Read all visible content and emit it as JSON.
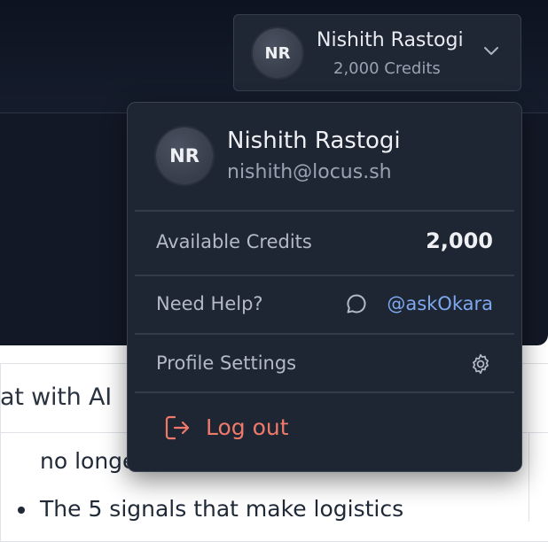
{
  "profile": {
    "initials": "NR",
    "name": "Nishith Rastogi",
    "credits_label": "2,000 Credits"
  },
  "dropdown": {
    "initials": "NR",
    "name": "Nishith Rastogi",
    "email": "nishith@locus.sh",
    "available_credits_label": "Available Credits",
    "available_credits_value": "2,000",
    "help_label": "Need Help?",
    "help_link": "@askOkara",
    "profile_settings_label": "Profile Settings",
    "logout_label": "Log out"
  },
  "background": {
    "article_header": "at with AI",
    "article_line1": "no longe",
    "article_line2": "The 5 signals that make logistics"
  },
  "icons": {
    "chevron": "chevron-down-icon",
    "chat": "chat-bubble-icon",
    "gear": "gear-icon",
    "logout": "logout-icon"
  },
  "colors": {
    "logout": "#f07a6a",
    "link": "#7fa9ee",
    "dropdown_bg": "#1e2533"
  }
}
